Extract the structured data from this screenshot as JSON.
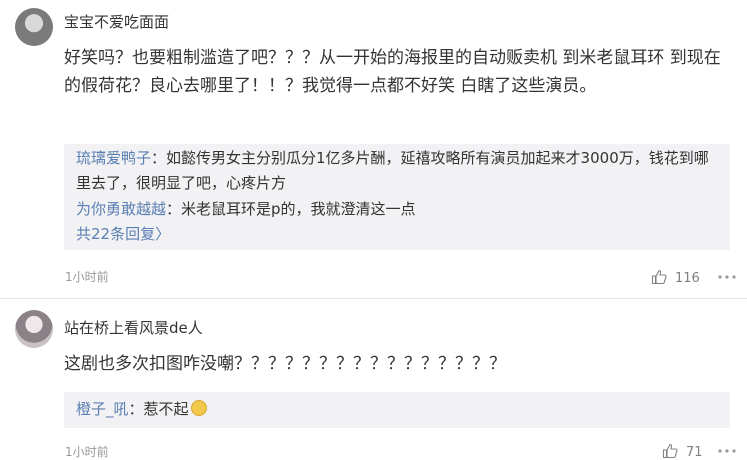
{
  "comments": [
    {
      "username": "宝宝不爱吃面面",
      "text": "好笑吗？也要粗制滥造了吧？？？从一开始的海报里的自动贩卖机 到米老鼠耳环 到现在的假荷花？良心去哪里了！！？我觉得一点都不好笑 白瞎了这些演员。",
      "replies": [
        {
          "user": "琉璃爱鸭子",
          "text": "：如懿传男女主分别瓜分1亿多片酬，延禧攻略所有演员加起来才3000万，钱花到哪里去了，很明显了吧，心疼片方"
        },
        {
          "user": "为你勇敢越越",
          "text": "：米老鼠耳环是p的，我就澄清这一点"
        }
      ],
      "more_replies": "共22条回复",
      "more_arrow": "〉",
      "time": "1小时前",
      "likes": "116"
    },
    {
      "username": "站在桥上看风景de人",
      "text": "这剧也多次扣图咋没嘲？？？？？？？？？？？？？？？？",
      "replies": [
        {
          "user": "橙子_吼",
          "text": "：惹不起"
        }
      ],
      "time": "1小时前",
      "likes": "71"
    }
  ],
  "colors": {
    "link": "#5b7fb2",
    "reply_bg": "#f2f2f5",
    "meta": "#999999"
  },
  "icons": [
    "thumbs-up-icon",
    "more-dots-icon",
    "laugh-emoji-icon"
  ]
}
